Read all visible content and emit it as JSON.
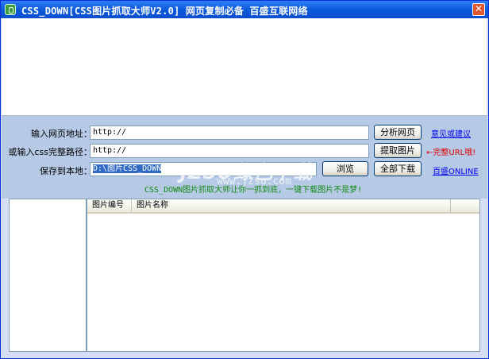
{
  "window": {
    "title": "CSS_DOWN[CSS图片抓取大师V2.0] 网页复制必备 百盛互联网络",
    "close_glyph": "✕"
  },
  "form": {
    "url_label": "输入网页地址：",
    "url_value": "http://",
    "css_label": "或输入css完整路径：",
    "css_value": "http://",
    "save_label": "保存到本地：",
    "save_value": "D:\\图片CSS_DOWN"
  },
  "buttons": {
    "analyze": "分析网页",
    "extract": "提取图片",
    "browse": "浏览",
    "download_all": "全部下载"
  },
  "links": {
    "feedback": "意见或建议",
    "online": "百盛ONLINE"
  },
  "hint": "←完整URL哦!",
  "slogan": "CSS_DOWN图片抓取大师让你一抓到底，一键下载图片不是梦!",
  "watermark": {
    "main": "JZSU绿色下载",
    "sub": "www.jzsu.com"
  },
  "table": {
    "columns": [
      "图片编号",
      "图片名称"
    ]
  }
}
